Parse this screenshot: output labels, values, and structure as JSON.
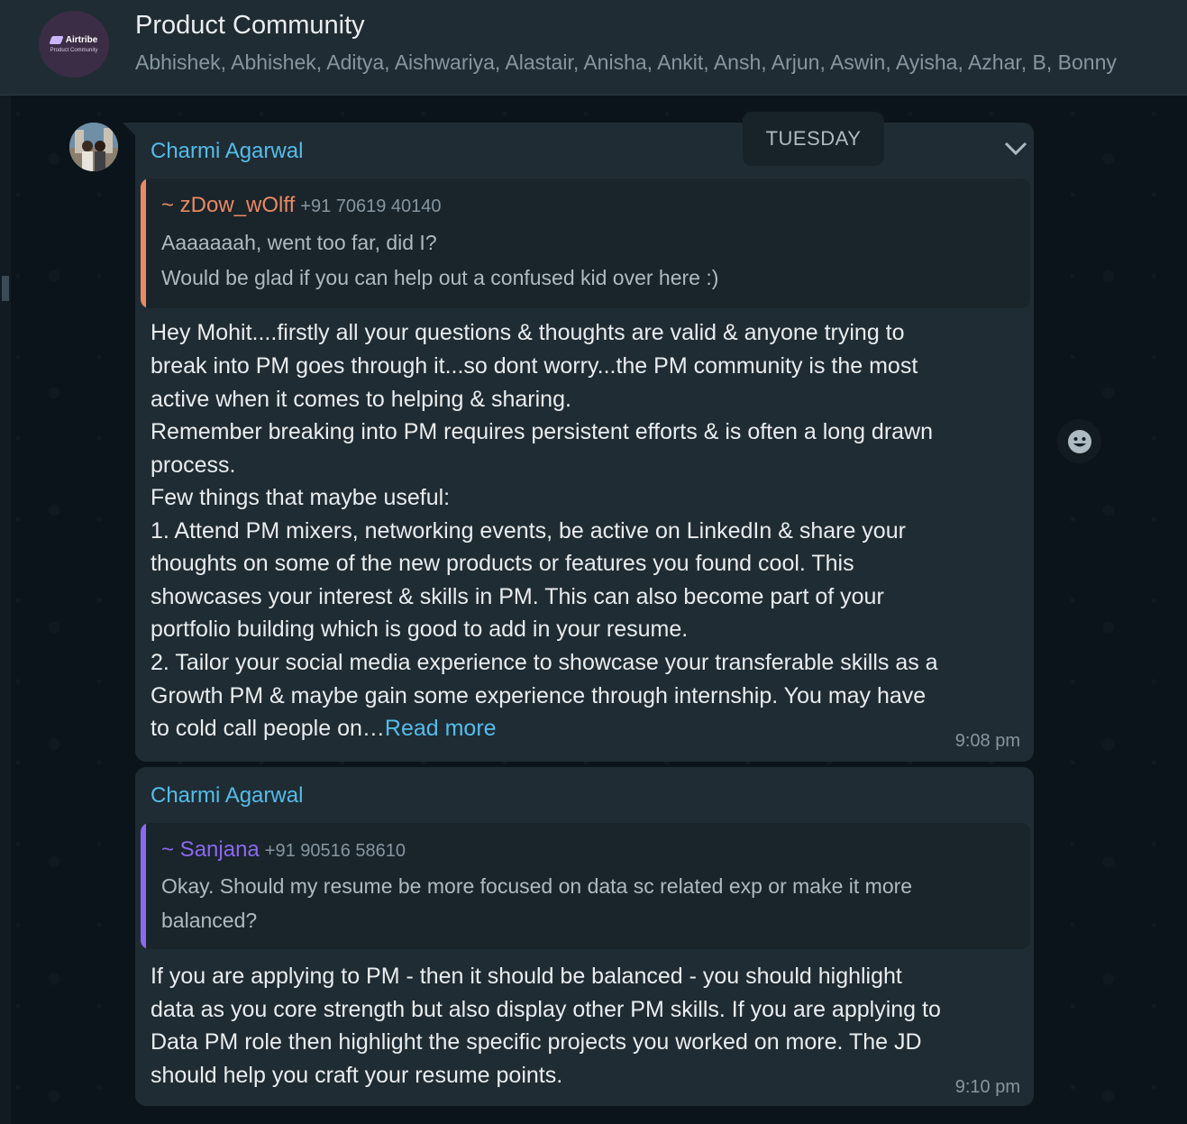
{
  "header": {
    "group_name": "Product Community",
    "members": "Abhishek, Abhishek, Aditya, Aishwariya, Alastair, Anisha, Ankit, Ansh, Arjun, Aswin, Ayisha, Azhar, B, Bonny",
    "avatar_brand": "Airtribe",
    "avatar_sub": "Product Community"
  },
  "day_separator": "TUESDAY",
  "messages": [
    {
      "sender": "Charmi Agarwal",
      "quote": {
        "author": "~ zDow_wOlff",
        "phone": "+91 70619 40140",
        "lines": [
          "Aaaaaaah, went too far, did I?",
          "Would be glad if you can help out a confused kid over here :)"
        ],
        "color": "#e98a63"
      },
      "body_lines": [
        "Hey Mohit....firstly all your questions & thoughts are valid & anyone trying to",
        "break into PM goes through it...so dont worry...the PM community is the most",
        "active when it comes to helping & sharing.",
        "Remember breaking into PM requires persistent efforts & is often a long drawn",
        "process.",
        "Few things that maybe useful:",
        "1. Attend PM mixers, networking events, be active on LinkedIn & share your",
        "thoughts on some of the new products or features you found cool. This",
        "showcases your interest & skills in PM. This can also become part of your",
        "portfolio building which is good to add in your resume.",
        "2. Tailor your social media experience to showcase your transferable skills as a",
        "Growth PM & maybe gain some experience through internship. You may have",
        "to cold call people on…"
      ],
      "read_more": "Read more",
      "time": "9:08 pm"
    },
    {
      "sender": "Charmi Agarwal",
      "quote": {
        "author": "~ Sanjana",
        "phone": "+91 90516 58610",
        "text": "Okay. Should my resume be more focused on data sc related exp or make it more balanced?",
        "color": "#8c69f0"
      },
      "body_lines": [
        "If you are applying to PM - then it should be balanced - you should highlight",
        "data as you core strength but also display other PM skills. If you are applying to",
        "Data PM role then highlight the specific projects you worked on more. The JD",
        "should help you craft your resume points."
      ],
      "time": "9:10 pm"
    }
  ],
  "icons": [
    "airtribe-logo-icon",
    "chevron-down-icon",
    "emoji-react-icon",
    "user-avatar-icon"
  ],
  "colors": {
    "sender_name": "#53bdeb",
    "bubble": "#202c33",
    "header": "#202c33",
    "background": "#0b141a"
  }
}
